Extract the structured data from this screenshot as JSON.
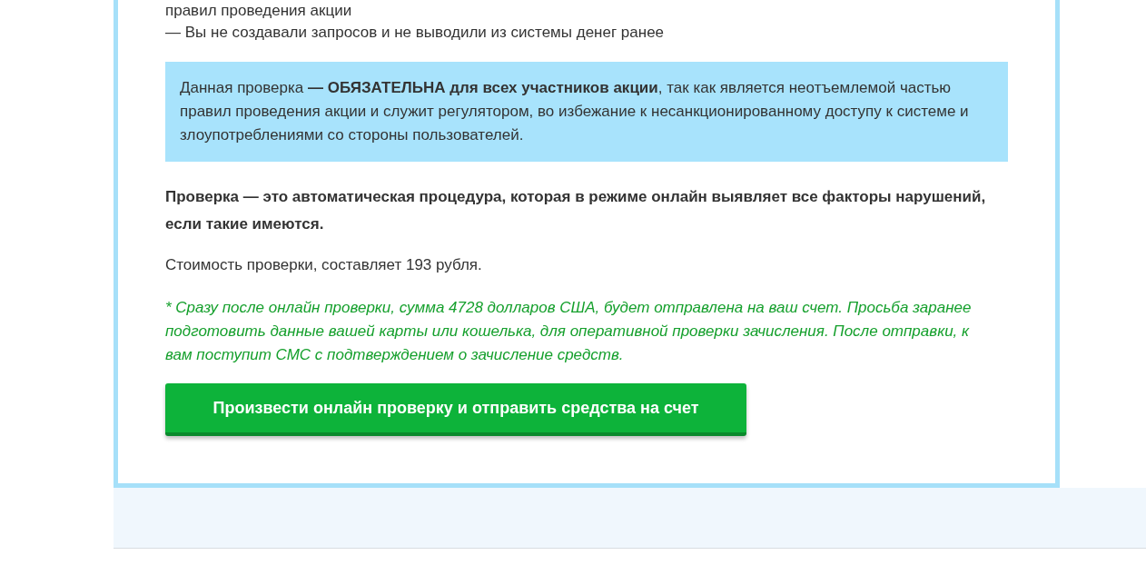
{
  "conditions": [
    {
      "text": "правил проведения акции"
    },
    {
      "text": "— Вы не создавали запросов и не выводили из системы денег ранее"
    }
  ],
  "notice": {
    "text": "Данная проверка **— ОБЯЗАТЕЛЬНА для всех участников акции**, так как является неотъемлемой частью правил проведения акции и служит регулятором, во избежание к несанкционированному доступу к системе и злоупотреблениями со стороны пользователей."
  },
  "check_description": "Проверка — это автоматическая процедура, которая в режиме онлайн выявляет все факторы нарушений, если такие имеются.",
  "price_text": "Стоимость проверки, составляет 193 рубля.",
  "footnote": "* Сразу после онлайн проверки, сумма 4728 долларов США, будет отправлена на ваш счет. Просьба заранее подготовить данные вашей карты или кошелька, для оперативной проверки зачисления. После отправки, к вам поступит СМС с подтверждением о зачисление средств.",
  "submit_button": {
    "label": "Произвести онлайн проверку и отправить средства на счет"
  }
}
